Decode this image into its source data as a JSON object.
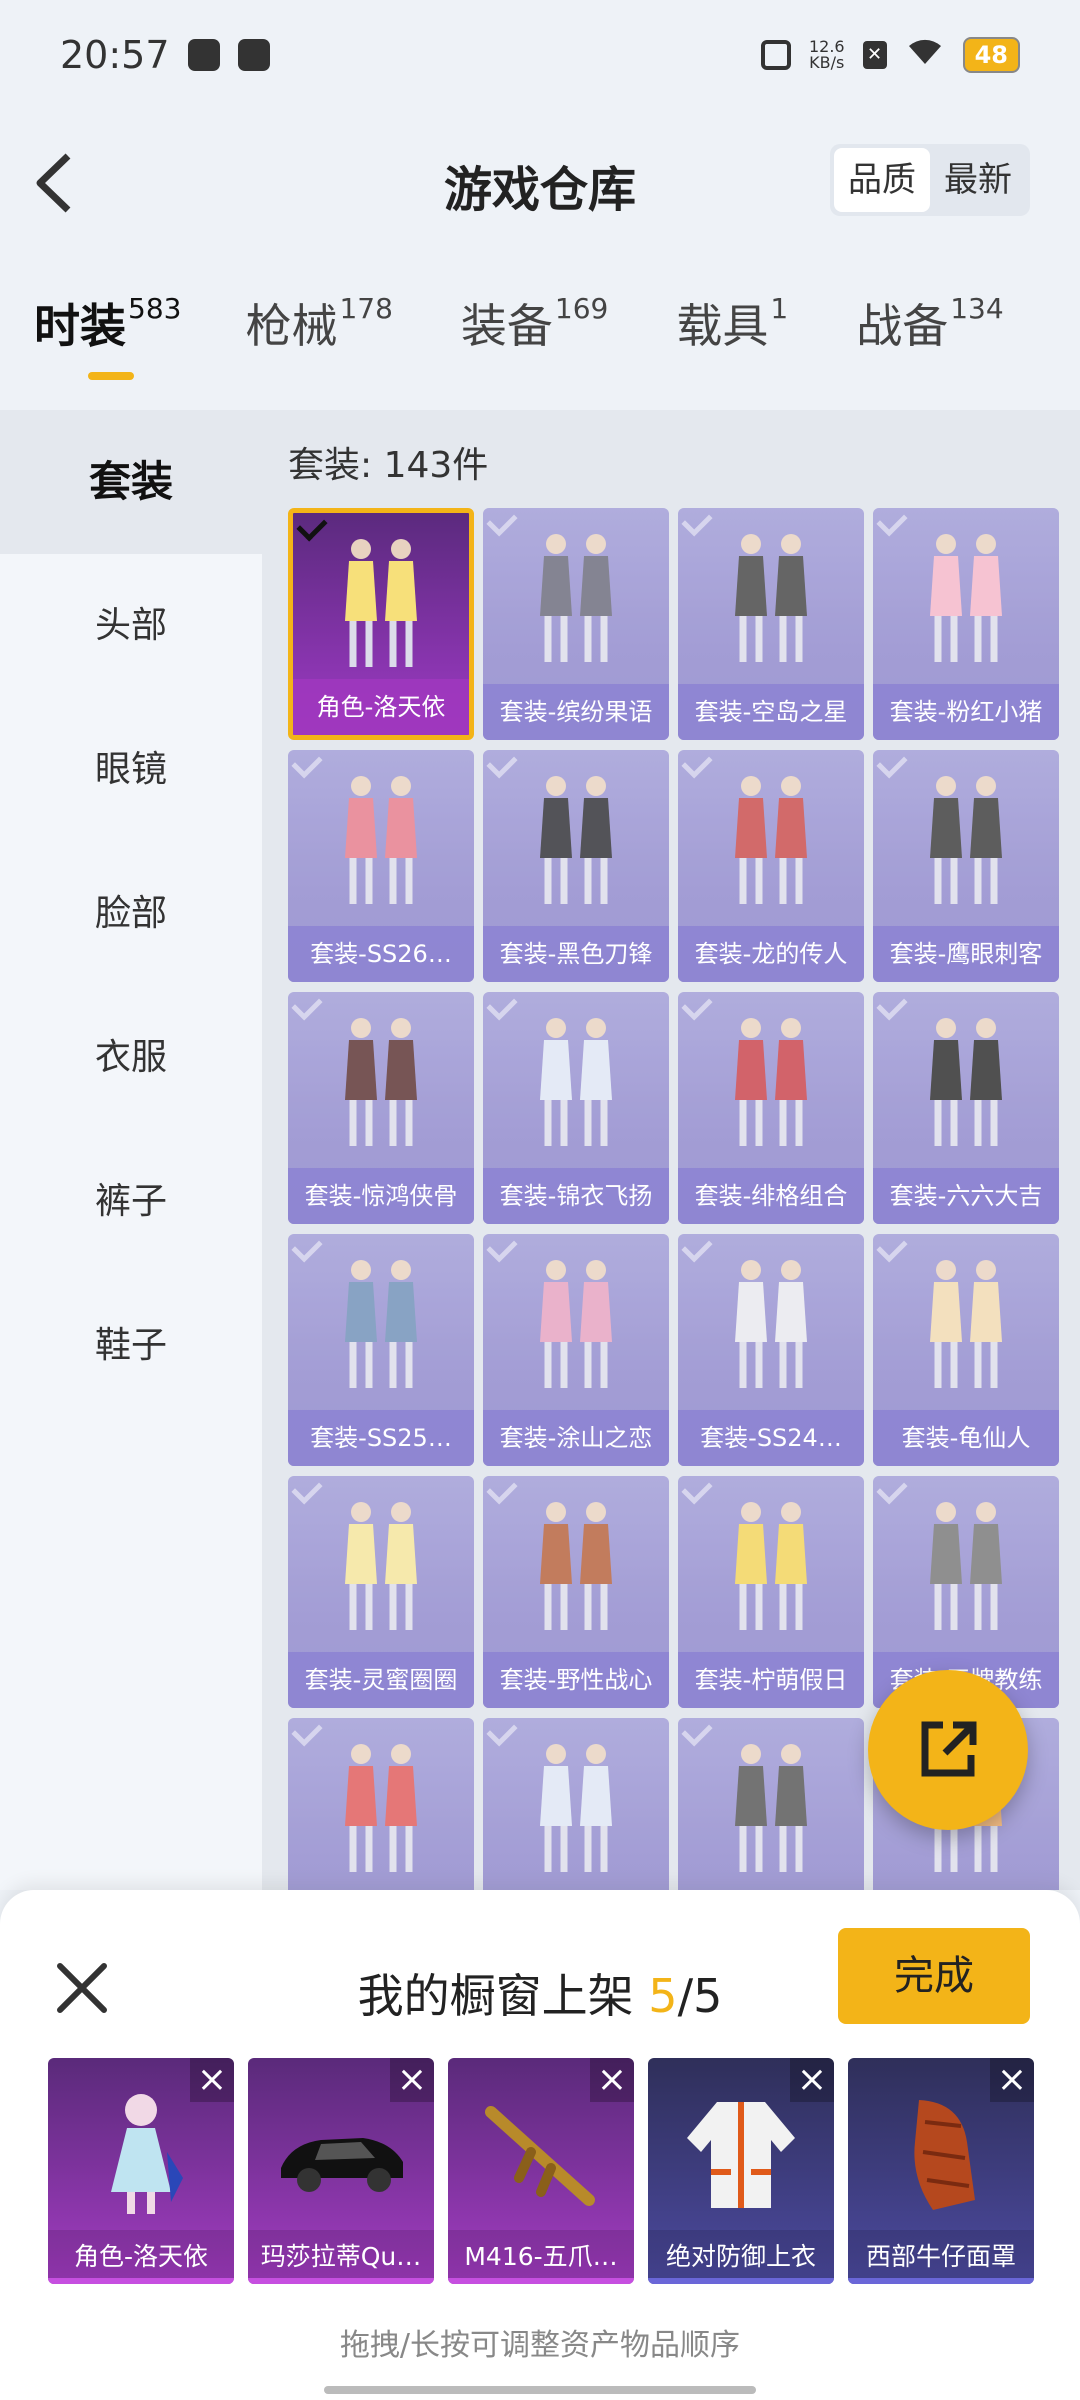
{
  "status": {
    "time": "20:57",
    "net_speed": "12.6",
    "net_unit": "KB/s",
    "battery": "48"
  },
  "header": {
    "title": "游戏仓库",
    "sort_quality": "品质",
    "sort_newest": "最新"
  },
  "tabs": [
    {
      "label": "时装",
      "count": "583"
    },
    {
      "label": "枪械",
      "count": "178"
    },
    {
      "label": "装备",
      "count": "169"
    },
    {
      "label": "载具",
      "count": "1"
    },
    {
      "label": "战备",
      "count": "134"
    }
  ],
  "sidebar": {
    "items": [
      "套装",
      "头部",
      "眼镜",
      "脸部",
      "衣服",
      "裤子",
      "鞋子"
    ]
  },
  "grid": {
    "title": "套装: 143件",
    "items": [
      "角色-洛天依",
      "套装-缤纷果语",
      "套装-空岛之星",
      "套装-粉红小猪",
      "套装-SS26…",
      "套装-黑色刀锋",
      "套装-龙的传人",
      "套装-鹰眼刺客",
      "套装-惊鸿侠骨",
      "套装-锦衣飞扬",
      "套装-绯格组合",
      "套装-六六大吉",
      "套装-SS25…",
      "套装-涂山之恋",
      "套装-SS24…",
      "套装-龟仙人",
      "套装-灵蜜圈圈",
      "套装-野性战心",
      "套装-柠萌假日",
      "套装-王牌教练",
      "",
      "",
      "",
      ""
    ]
  },
  "panel": {
    "title_prefix": "我的橱窗上架 ",
    "count_current": "5",
    "count_sep": "/",
    "count_total": "5",
    "done_label": "完成",
    "remove_glyph": "×",
    "hint": "拖拽/长按可调整资产物品顺序",
    "shelf": [
      "角色-洛天依",
      "玛莎拉蒂Qu…",
      "M416-五爪…",
      "绝对防御上衣",
      "西部牛仔面罩"
    ]
  },
  "colors": {
    "accent": "#f3b418",
    "card": "#8f88cc",
    "selected_card": "#8a35b0"
  }
}
